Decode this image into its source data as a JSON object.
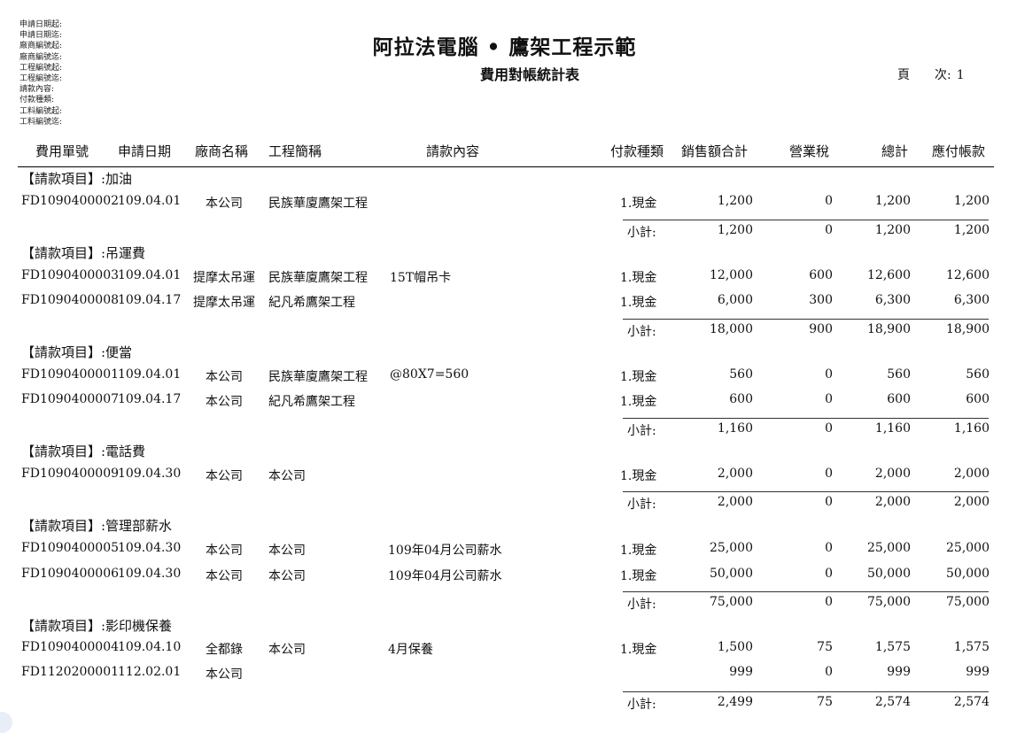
{
  "filters": [
    "申請日期起:",
    "申請日期迄:",
    "廠商編號起:",
    "廠商編號迄:",
    "工程編號起:",
    "工程編號迄:",
    "請款內容:",
    "付款種類:",
    "工料編號起:",
    "工料編號迄:"
  ],
  "report": {
    "title": "阿拉法電腦 • 鷹架工程示範",
    "subtitle": "費用對帳統計表",
    "page_label": "頁　　次:",
    "page_number": "1"
  },
  "columns": {
    "doc_no": "費用單號",
    "date": "申請日期",
    "vendor": "廠商名稱",
    "project": "工程簡稱",
    "content": "請款內容",
    "pay_type": "付款種類",
    "sales": "銷售額合計",
    "tax": "營業稅",
    "total": "總計",
    "payable": "應付帳款"
  },
  "group_prefix": "【請款項目】:",
  "subtotal_label": "小計:",
  "groups": [
    {
      "name": "加油",
      "rows": [
        {
          "doc_no": "FD1090400002",
          "date": "109.04.01",
          "vendor": "本公司",
          "project": "民族華廈鷹架工程",
          "content": "",
          "content_left": false,
          "pay_type": "1.現金",
          "sales": "1,200",
          "tax": "0",
          "total": "1,200",
          "payable": "1,200"
        }
      ],
      "subtotal": {
        "sales": "1,200",
        "tax": "0",
        "total": "1,200",
        "payable": "1,200"
      }
    },
    {
      "name": "吊運費",
      "rows": [
        {
          "doc_no": "FD1090400003",
          "date": "109.04.01",
          "vendor": "提摩太吊運",
          "project": "民族華廈鷹架工程",
          "content": "15T帽吊卡",
          "content_left": false,
          "pay_type": "1.現金",
          "sales": "12,000",
          "tax": "600",
          "total": "12,600",
          "payable": "12,600"
        },
        {
          "doc_no": "FD1090400008",
          "date": "109.04.17",
          "vendor": "提摩太吊運",
          "project": "紀凡希鷹架工程",
          "content": "",
          "content_left": false,
          "pay_type": "1.現金",
          "sales": "6,000",
          "tax": "300",
          "total": "6,300",
          "payable": "6,300"
        }
      ],
      "subtotal": {
        "sales": "18,000",
        "tax": "900",
        "total": "18,900",
        "payable": "18,900"
      }
    },
    {
      "name": "便當",
      "rows": [
        {
          "doc_no": "FD1090400001",
          "date": "109.04.01",
          "vendor": "本公司",
          "project": "民族華廈鷹架工程",
          "content": "@80X7=560",
          "content_left": false,
          "pay_type": "1.現金",
          "sales": "560",
          "tax": "0",
          "total": "560",
          "payable": "560"
        },
        {
          "doc_no": "FD1090400007",
          "date": "109.04.17",
          "vendor": "本公司",
          "project": "紀凡希鷹架工程",
          "content": "",
          "content_left": false,
          "pay_type": "1.現金",
          "sales": "600",
          "tax": "0",
          "total": "600",
          "payable": "600"
        }
      ],
      "subtotal": {
        "sales": "1,160",
        "tax": "0",
        "total": "1,160",
        "payable": "1,160"
      }
    },
    {
      "name": "電話費",
      "rows": [
        {
          "doc_no": "FD1090400009",
          "date": "109.04.30",
          "vendor": "本公司",
          "project": "本公司",
          "content": "",
          "content_left": false,
          "pay_type": "1.現金",
          "sales": "2,000",
          "tax": "0",
          "total": "2,000",
          "payable": "2,000"
        }
      ],
      "subtotal": {
        "sales": "2,000",
        "tax": "0",
        "total": "2,000",
        "payable": "2,000"
      }
    },
    {
      "name": "管理部薪水",
      "rows": [
        {
          "doc_no": "FD1090400005",
          "date": "109.04.30",
          "vendor": "本公司",
          "project": "本公司",
          "content": "109年04月公司薪水",
          "content_left": true,
          "pay_type": "1.現金",
          "sales": "25,000",
          "tax": "0",
          "total": "25,000",
          "payable": "25,000"
        },
        {
          "doc_no": "FD1090400006",
          "date": "109.04.30",
          "vendor": "本公司",
          "project": "本公司",
          "content": "109年04月公司薪水",
          "content_left": true,
          "pay_type": "1.現金",
          "sales": "50,000",
          "tax": "0",
          "total": "50,000",
          "payable": "50,000"
        }
      ],
      "subtotal": {
        "sales": "75,000",
        "tax": "0",
        "total": "75,000",
        "payable": "75,000"
      }
    },
    {
      "name": "影印機保養",
      "rows": [
        {
          "doc_no": "FD1090400004",
          "date": "109.04.10",
          "vendor": "全都錄",
          "project": "本公司",
          "content": "4月保養",
          "content_left": true,
          "pay_type": "1.現金",
          "sales": "1,500",
          "tax": "75",
          "total": "1,575",
          "payable": "1,575"
        },
        {
          "doc_no": "FD1120200001",
          "date": "112.02.01",
          "vendor": "本公司",
          "project": "",
          "content": "",
          "content_left": false,
          "pay_type": "",
          "sales": "999",
          "tax": "0",
          "total": "999",
          "payable": "999"
        }
      ],
      "subtotal": {
        "sales": "2,499",
        "tax": "75",
        "total": "2,574",
        "payable": "2,574"
      }
    }
  ]
}
